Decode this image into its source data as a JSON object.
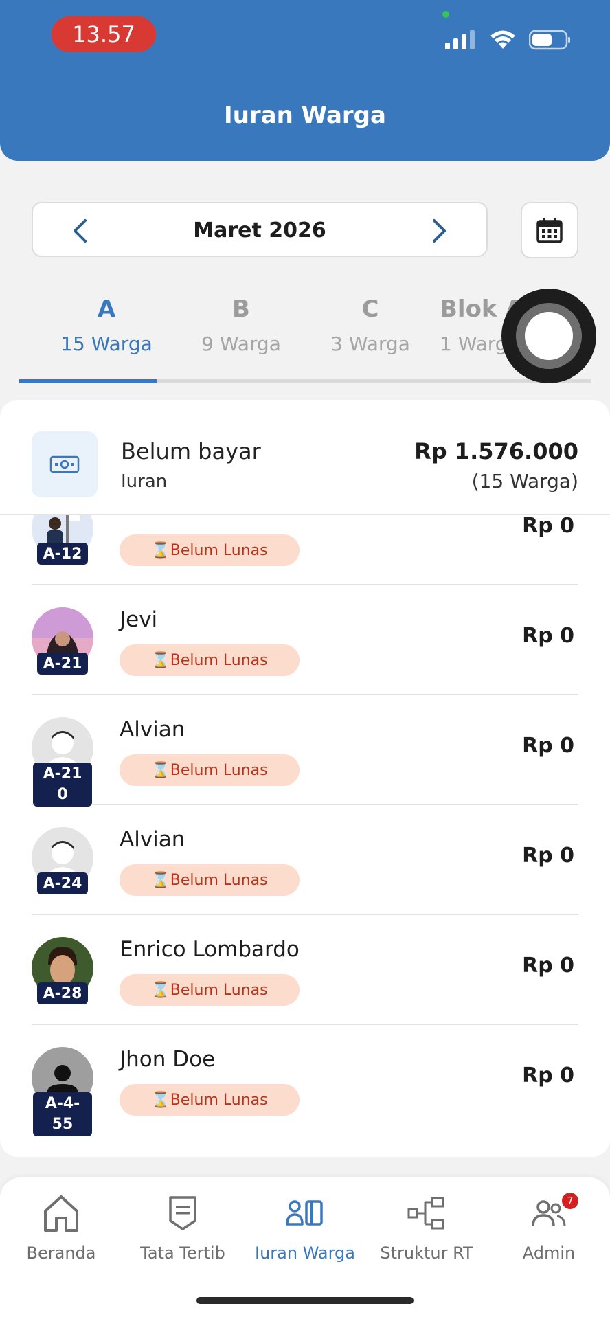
{
  "status_bar": {
    "time": "13.57"
  },
  "header": {
    "title": "Iuran Warga"
  },
  "month_selector": {
    "label": "Maret 2026"
  },
  "tabs": [
    {
      "letter": "A",
      "count": "15 Warga"
    },
    {
      "letter": "B",
      "count": "9 Warga"
    },
    {
      "letter": "C",
      "count": "3 Warga"
    },
    {
      "letter": "Blok A...r",
      "count": "1 Warga"
    }
  ],
  "summary": {
    "title": "Belum bayar",
    "subtitle": "Iuran",
    "amount": "Rp 1.576.000",
    "count": "(15 Warga)"
  },
  "rows": [
    {
      "name": "",
      "block": "A-12",
      "status": "⌛Belum Lunas",
      "amount": "Rp 0"
    },
    {
      "name": "Jevi",
      "block": "A-21",
      "status": "⌛Belum Lunas",
      "amount": "Rp 0"
    },
    {
      "name": "Alvian",
      "block": "A-21\n0",
      "status": "⌛Belum Lunas",
      "amount": "Rp 0"
    },
    {
      "name": "Alvian",
      "block": "A-24",
      "status": "⌛Belum Lunas",
      "amount": "Rp 0"
    },
    {
      "name": "Enrico Lombardo",
      "block": "A-28",
      "status": "⌛Belum Lunas",
      "amount": "Rp 0"
    },
    {
      "name": "Jhon Doe",
      "block": "A-4-\n55",
      "status": "⌛Belum Lunas",
      "amount": "Rp 0"
    }
  ],
  "bottom_nav": [
    {
      "label": "Beranda",
      "icon": "home-icon"
    },
    {
      "label": "Tata Tertib",
      "icon": "rules-icon"
    },
    {
      "label": "Iuran Warga",
      "icon": "dues-icon"
    },
    {
      "label": "Struktur RT",
      "icon": "structure-icon"
    },
    {
      "label": "Admin",
      "icon": "admin-icon",
      "badge": "7"
    }
  ],
  "colors": {
    "primary": "#3a78bd",
    "danger": "#d83a33",
    "badge_navy": "#14214e",
    "pill_bg": "#fcdccc"
  }
}
